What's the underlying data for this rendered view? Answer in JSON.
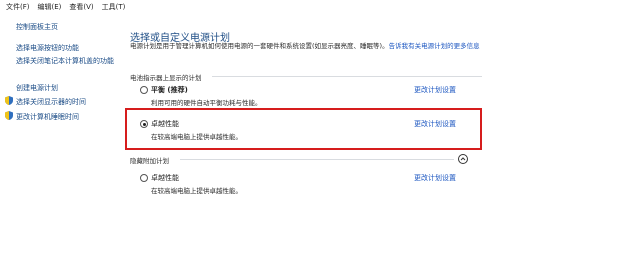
{
  "menubar": {
    "items": [
      {
        "label": "文件(F)"
      },
      {
        "label": "编辑(E)"
      },
      {
        "label": "查看(V)"
      },
      {
        "label": "工具(T)"
      }
    ]
  },
  "sidebar": {
    "items": [
      {
        "label": "控制面板主页"
      },
      {
        "label": "选择电源按钮的功能"
      },
      {
        "label": "选择关闭笔记本计算机盖的功能"
      },
      {
        "label": "创建电源计划"
      },
      {
        "label": "选择关闭显示器的时间"
      },
      {
        "label": "更改计算机睡眠时间"
      }
    ]
  },
  "main": {
    "title": "选择或自定义电源计划",
    "intro_text": "电源计划是用于管理计算机如何使用电源的一套硬件和系统设置(如显示器亮度、睡眠等)。",
    "intro_link": "告诉我有关电源计划的更多信息",
    "battery_section_label": "电池指示器上显示的计划",
    "hidden_section_label": "隐藏附加计划",
    "plans": [
      {
        "name": "平衡 (推荐)",
        "description": "利用可用的硬件自动平衡功耗与性能。",
        "link": "更改计划设置",
        "selected": false
      },
      {
        "name": "卓越性能",
        "description": "在较高端电脑上提供卓越性能。",
        "link": "更改计划设置",
        "selected": true
      }
    ],
    "hidden_plans": [
      {
        "name": "卓越性能",
        "description": "在较高端电脑上提供卓越性能。",
        "link": "更改计划设置",
        "selected": false
      }
    ]
  },
  "colors": {
    "link": "#1a55c0",
    "title": "#1f4e86",
    "highlight_border": "#d61d1d"
  }
}
